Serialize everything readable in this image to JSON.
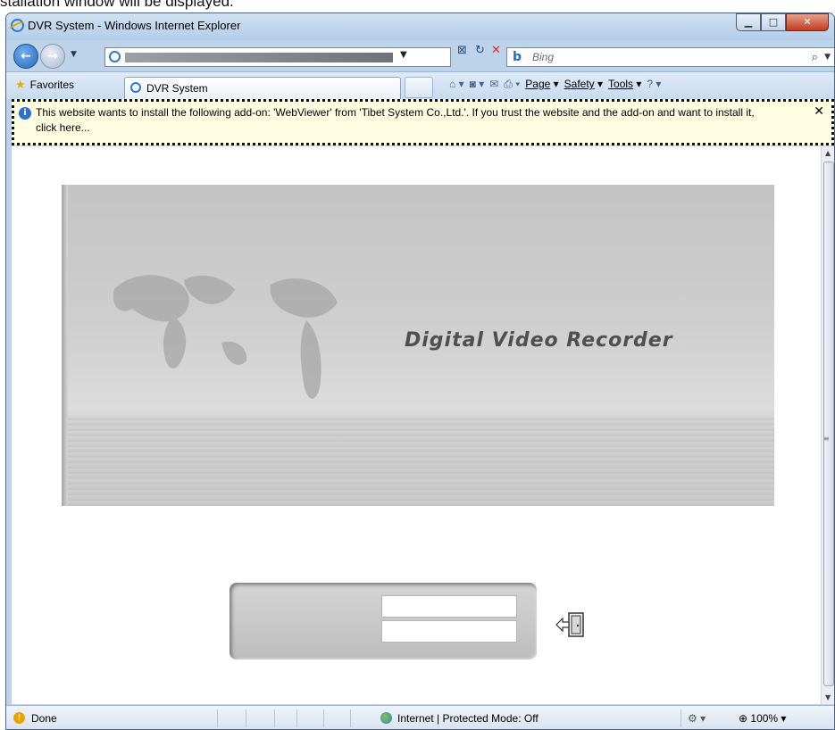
{
  "caption": "stallation window will be displayed.",
  "window": {
    "title": "DVR System - Windows Internet Explorer"
  },
  "nav": {
    "search_placeholder": "Bing"
  },
  "favorites": {
    "label": "Favorites",
    "tab_title": "DVR System"
  },
  "commands": {
    "page": "Page",
    "safety": "Safety",
    "tools": "Tools"
  },
  "infobar": {
    "message": "This website wants to install the following add-on: 'WebViewer' from 'Tibet System Co.,Ltd.'. If you trust the website and the add-on and want to install it, click here..."
  },
  "banner": {
    "title": "Digital Video Recorder"
  },
  "login": {
    "username": "",
    "password": ""
  },
  "status": {
    "text": "Done",
    "zone": "Internet | Protected Mode: Off",
    "zoom": "100%"
  }
}
